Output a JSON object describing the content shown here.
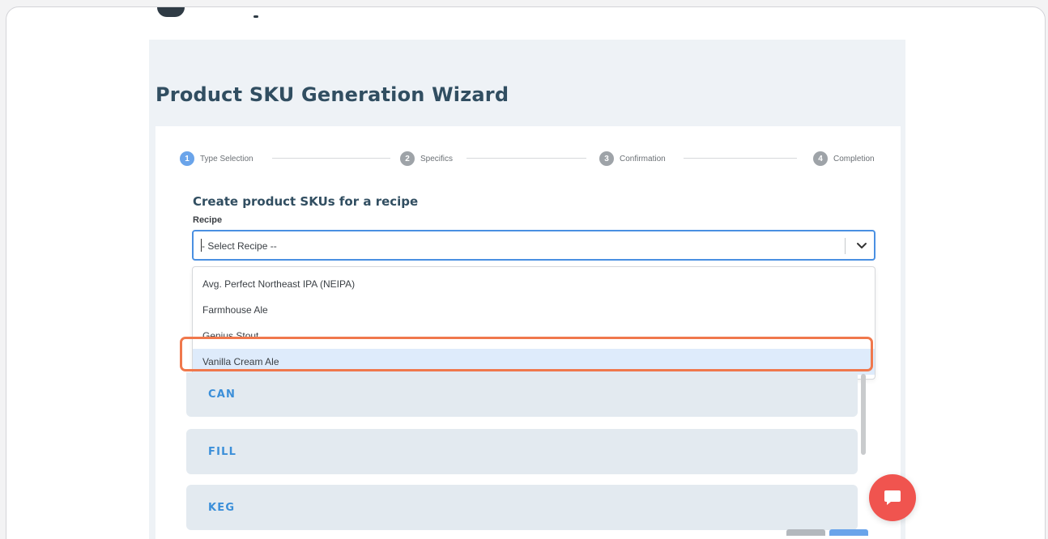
{
  "page": {
    "title": "Product SKU Generation Wizard"
  },
  "stepper": {
    "steps": [
      {
        "num": "1",
        "label": "Type Selection",
        "active": true
      },
      {
        "num": "2",
        "label": "Specifics",
        "active": false
      },
      {
        "num": "3",
        "label": "Confirmation",
        "active": false
      },
      {
        "num": "4",
        "label": "Completion",
        "active": false
      }
    ]
  },
  "form": {
    "section_title": "Create product SKUs for a recipe",
    "recipe_label": "Recipe",
    "recipe_placeholder": "- Select Recipe --"
  },
  "dropdown": {
    "options": [
      "Avg. Perfect Northeast IPA (NEIPA)",
      "Farmhouse Ale",
      "Genius Stout",
      "Vanilla Cream Ale"
    ],
    "highlighted_index": 3
  },
  "sku_types": [
    "CAN",
    "FILL",
    "KEG"
  ],
  "colors": {
    "accent": "#4a90e2",
    "highlight_ring": "#f0784c",
    "chat_button": "#f0544f",
    "title": "#314e61"
  },
  "icons": {
    "dropdown": "chevron-down-icon",
    "chat": "chat-bubble-icon"
  }
}
